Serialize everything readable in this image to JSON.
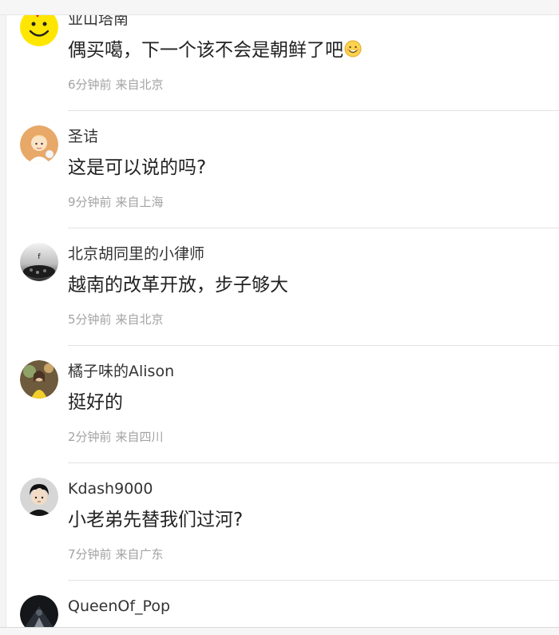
{
  "comments": [
    {
      "user": "业山塔南",
      "text": "偶买噶，下一个该不会是朝鲜了吧",
      "emoji": "smile-emoji",
      "time": "6分钟前",
      "location": "来自北京",
      "avatar": "yellow-smiley-avatar"
    },
    {
      "user": "圣诘",
      "text": "这是可以说的吗?",
      "time": "9分钟前",
      "location": "来自上海",
      "avatar": "cartoon-boy-avatar"
    },
    {
      "user": "北京胡同里的小律师",
      "text": "越南的改革开放，步子够大",
      "time": "5分钟前",
      "location": "来自北京",
      "avatar": "dark-logo-avatar"
    },
    {
      "user": "橘子味的Alison",
      "text": "挺好的",
      "time": "2分钟前",
      "location": "来自四川",
      "avatar": "photo-person-avatar"
    },
    {
      "user": "Kdash9000",
      "text": "小老弟先替我们过河?",
      "time": "7分钟前",
      "location": "来自广东",
      "avatar": "cartoon-dark-hair-avatar"
    },
    {
      "user": "QueenOf_Pop",
      "avatar": "dark-stage-avatar"
    }
  ]
}
